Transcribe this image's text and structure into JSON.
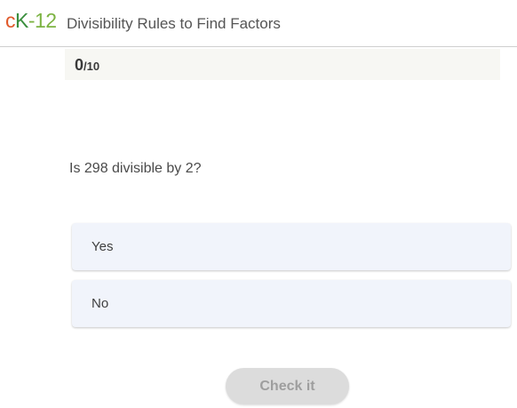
{
  "header": {
    "logo": {
      "c": "c",
      "k": "K",
      "rest": "-12"
    },
    "title": "Divisibility Rules to Find Factors"
  },
  "score": {
    "value": "0",
    "total": "/10"
  },
  "question": {
    "text": "Is 298 divisible by 2?"
  },
  "options": [
    {
      "label": "Yes"
    },
    {
      "label": "No"
    }
  ],
  "actions": {
    "check_label": "Check it"
  },
  "colors": {
    "logo_c": "#e0592a",
    "logo_k": "#3a8f3e",
    "logo_12": "#7cb342",
    "option_bg": "#f1f4fb",
    "button_disabled_bg": "#dcdcdc"
  }
}
